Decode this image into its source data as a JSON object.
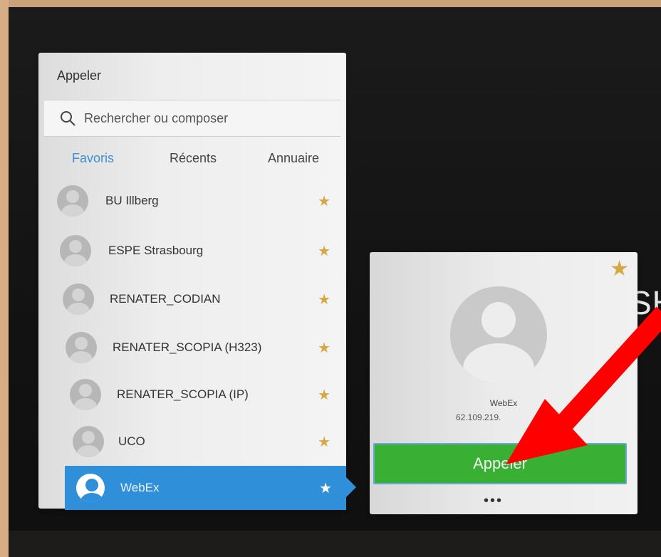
{
  "panel": {
    "title": "Appeler",
    "search_placeholder": "Rechercher ou composer",
    "search_icon": "search-icon",
    "tabs": [
      {
        "label": "Favoris",
        "active": true
      },
      {
        "label": "Récents",
        "active": false
      },
      {
        "label": "Annuaire",
        "active": false
      }
    ],
    "contacts": [
      {
        "name": "BU Illberg",
        "favorite": true
      },
      {
        "name": "ESPE Strasbourg",
        "favorite": true
      },
      {
        "name": "RENATER_CODIAN",
        "favorite": true
      },
      {
        "name": "RENATER_SCOPIA (H323)",
        "favorite": true
      },
      {
        "name": "RENATER_SCOPIA (IP)",
        "favorite": true
      },
      {
        "name": "UCO",
        "favorite": true
      },
      {
        "name": "WebEx",
        "favorite": true,
        "selected": true
      }
    ]
  },
  "card": {
    "name": "WebEx",
    "address": "62.109.219.",
    "call_label": "Appeler",
    "more_label": "•••",
    "favorite": true
  },
  "background": {
    "partial_text": "SH"
  },
  "colors": {
    "accent_blue": "#2f8fd8",
    "call_green": "#39b033",
    "star_gold": "#d4a843",
    "annotation_red": "#ff0000"
  }
}
